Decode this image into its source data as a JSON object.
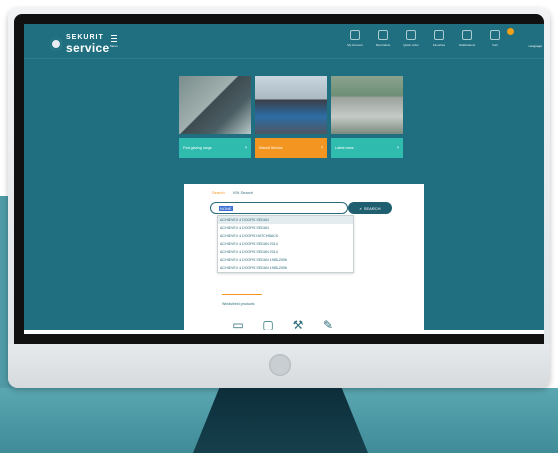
{
  "brand": {
    "top": "SEKURIT",
    "bottom": "service"
  },
  "menu": {
    "label": "Menu"
  },
  "nav": [
    {
      "icon": "box-icon",
      "label": "My Account"
    },
    {
      "icon": "bell-icon",
      "label": "Reminders"
    },
    {
      "icon": "pin-icon",
      "label": "Quick order"
    },
    {
      "icon": "heart-icon",
      "label": "Favorites"
    },
    {
      "icon": "bell-icon",
      "label": "Notifications"
    },
    {
      "icon": "cart-icon",
      "label": "Cart"
    }
  ],
  "language": "Language",
  "tiles": [
    {
      "label": "Find glazing range"
    },
    {
      "label": "Sekurit Service"
    },
    {
      "label": "Latest news"
    }
  ],
  "search": {
    "tab_active": "Search",
    "tab": "VIN Search",
    "input_value": "NONE",
    "button_label": "SEARCH"
  },
  "dropdown": [
    "ACHIEVEV 4 DOORS SEDAN",
    "ACHIEVEV 4 DOORS SEDAN",
    "ACHIEVEV 4 DOORS HATCHBACK",
    "ACHIEVEV 4 DOORS SEDAN 2014",
    "ACHIEVEV 4 DOORS SEDAN 2014",
    "ACHIEVEV 4 DOORS SEDAN 1985-2006",
    "ACHIEVEV 4 DOORS SEDAN 1985-2006"
  ],
  "products": {
    "title": "Windshield products"
  }
}
